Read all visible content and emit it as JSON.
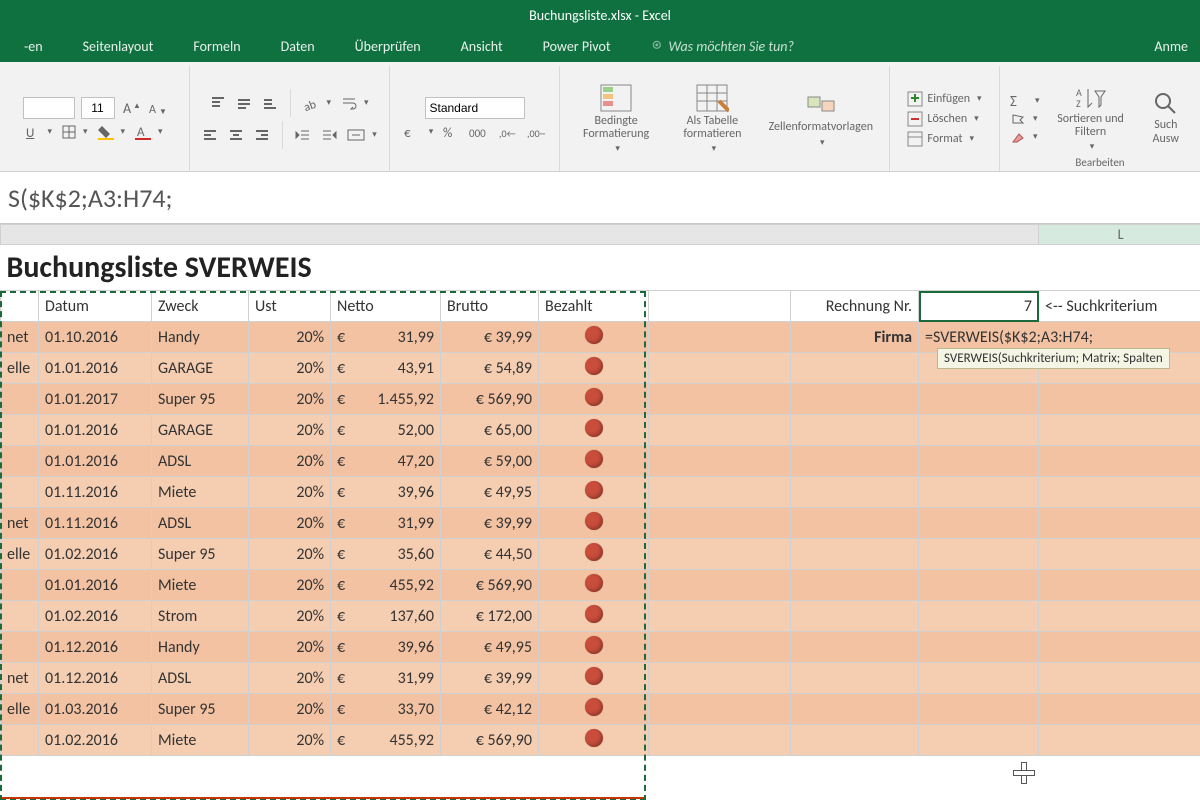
{
  "app": {
    "title": "Buchungsliste.xlsx - Excel"
  },
  "menu": {
    "tabs": [
      "-en",
      "Seitenlayout",
      "Formeln",
      "Daten",
      "Überprüfen",
      "Ansicht",
      "Power Pivot"
    ],
    "tellme": "Was möchten Sie tun?",
    "signin": "Anme"
  },
  "ribbon": {
    "font_size": "11",
    "number_format": "Standard",
    "bedingte": "Bedingte Formatierung",
    "alstable": "Als Tabelle formatieren",
    "zellvorlagen": "Zellenformatvorlagen",
    "einfuegen": "Einfügen",
    "loeschen": "Löschen",
    "format": "Format",
    "sort_label": "Sortieren und Filtern",
    "find_label": "Such Ausw",
    "group_edit": "Bearbeiten"
  },
  "formula_bar": "S($K$2;A3:H74;",
  "sheet": {
    "col_L": "L",
    "title": "Buchungsliste SVERWEIS",
    "headers": [
      "Datum",
      "Zweck",
      "Ust",
      "Netto",
      "Brutto",
      "Bezahlt"
    ],
    "rows": [
      {
        "firma": "net",
        "datum": "01.10.2016",
        "zweck": "Handy",
        "ust": "20%",
        "netto": "31,99",
        "brutto": "€ 39,99"
      },
      {
        "firma": "elle",
        "datum": "01.01.2016",
        "zweck": "GARAGE",
        "ust": "20%",
        "netto": "43,91",
        "brutto": "€ 54,89"
      },
      {
        "firma": "",
        "datum": "01.01.2017",
        "zweck": "Super 95",
        "ust": "20%",
        "netto": "1.455,92",
        "brutto": "€ 569,90"
      },
      {
        "firma": "",
        "datum": "01.01.2016",
        "zweck": "GARAGE",
        "ust": "20%",
        "netto": "52,00",
        "brutto": "€ 65,00"
      },
      {
        "firma": "",
        "datum": "01.01.2016",
        "zweck": "ADSL",
        "ust": "20%",
        "netto": "47,20",
        "brutto": "€ 59,00"
      },
      {
        "firma": "",
        "datum": "01.11.2016",
        "zweck": "Miete",
        "ust": "20%",
        "netto": "39,96",
        "brutto": "€ 49,95"
      },
      {
        "firma": "net",
        "datum": "01.11.2016",
        "zweck": "ADSL",
        "ust": "20%",
        "netto": "31,99",
        "brutto": "€ 39,99"
      },
      {
        "firma": "elle",
        "datum": "01.02.2016",
        "zweck": "Super 95",
        "ust": "20%",
        "netto": "35,60",
        "brutto": "€ 44,50"
      },
      {
        "firma": "",
        "datum": "01.01.2016",
        "zweck": "Miete",
        "ust": "20%",
        "netto": "455,92",
        "brutto": "€ 569,90"
      },
      {
        "firma": "",
        "datum": "01.02.2016",
        "zweck": "Strom",
        "ust": "20%",
        "netto": "137,60",
        "brutto": "€ 172,00"
      },
      {
        "firma": "",
        "datum": "01.12.2016",
        "zweck": "Handy",
        "ust": "20%",
        "netto": "39,96",
        "brutto": "€ 49,95"
      },
      {
        "firma": "net",
        "datum": "01.12.2016",
        "zweck": "ADSL",
        "ust": "20%",
        "netto": "31,99",
        "brutto": "€ 39,99"
      },
      {
        "firma": "elle",
        "datum": "01.03.2016",
        "zweck": "Super 95",
        "ust": "20%",
        "netto": "33,70",
        "brutto": "€ 42,12"
      },
      {
        "firma": "",
        "datum": "01.02.2016",
        "zweck": "Miete",
        "ust": "20%",
        "netto": "455,92",
        "brutto": "€ 569,90"
      }
    ],
    "eur": "€"
  },
  "lookup": {
    "rechnung_label": "Rechnung Nr.",
    "rechnung_val": "7",
    "rechnung_hint": "<-- Suchkriterium",
    "firma_label": "Firma",
    "firma_val": "=SVERWEIS($K$2;A3:H74;",
    "tooltip": "SVERWEIS(Suchkriterium; Matrix; Spalten"
  }
}
